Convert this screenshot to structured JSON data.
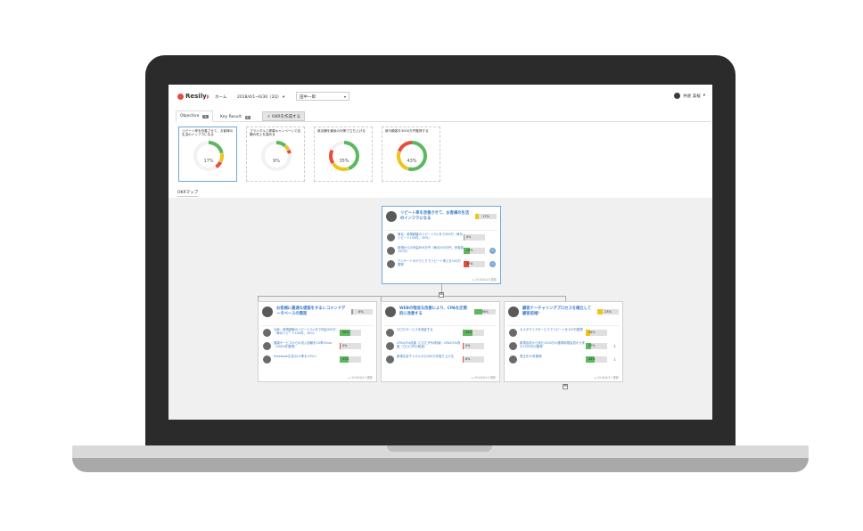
{
  "header": {
    "logo_text": "Resily",
    "logo_sup": "β",
    "nav_home": "ホーム",
    "period": "2018/4/1~6/30（2Q）",
    "period_caret": "▾",
    "dept": "田中一郎",
    "dept_caret": "▾",
    "user_name": "井倉 美桜",
    "user_caret": "▾"
  },
  "tabs": {
    "objective_label": "Objective",
    "objective_count": "4",
    "kr_label": "Key Result",
    "kr_count": "8",
    "create_button": "＋ OKRを作成する"
  },
  "objective_cards": [
    {
      "title": "リピート率を改善させて、お客様の生活のインフラになる",
      "progress": 17,
      "pct_text": "17%"
    },
    {
      "title": "ブライダルと健康キャンペーンで店舗の売上を高める",
      "progress": 9,
      "pct_text": "9%"
    },
    {
      "title": "新店舗を最後の対策で立ち上げる",
      "progress": 35,
      "pct_text": "35%"
    },
    {
      "title": "新行顧客を3000万円獲得する",
      "progress": 43,
      "pct_text": "43%"
    }
  ],
  "map": {
    "label": "OKRマップ",
    "expand_symbol": "⊞",
    "root": {
      "title": "リピート率を改善させて、お客様の生活のインフラになる",
      "progress_text": "17%",
      "progress": 17,
      "footer": "◎ 2018/6/18 更新",
      "krs": [
        {
          "text": "東京：新規顧客のリピート3ヶ月で450万（毎月リピート100件、30%）",
          "progress_text": "0%",
          "progress": 0,
          "color": "#999999",
          "icon": ""
        },
        {
          "text": "新規からの利益600万円（毎月200万円、来客各150万）",
          "progress_text": "28%",
          "progress": 28,
          "color": "#5cb85c",
          "icon": "⚠"
        },
        {
          "text": "アンケートのやりとりでリピート率上を150万獲得",
          "progress_text": "23%",
          "progress": 23,
          "color": "#e84c3d",
          "icon": "⚠"
        }
      ]
    },
    "children": [
      {
        "title": "お客様に最適な提案をするレコメンドデータベースの開発",
        "progress_text": "8%",
        "progress": 8,
        "footer": "◎ 2018/6/14 更新",
        "krs": [
          {
            "text": "大阪：新規顧客のリピート3ヶ月で利益450万（毎月リピート100件、30%）",
            "progress_text": "50%",
            "progress": 50,
            "color": "#5cb85c",
            "icon": ""
          },
          {
            "text": "健康サービスからの流入週報をCV率3%up（XXXX件獲得）",
            "progress_text": "0%",
            "progress": 0,
            "color": "#e84c3d",
            "icon": ""
          },
          {
            "text": "Facebook広告のCV率を15%へ",
            "progress_text": "41%",
            "progress": 41,
            "color": "#5cb85c",
            "icon": ""
          }
        ]
      },
      {
        "title": "WEBの物流な改善により、CPAを圧倒的に改善する",
        "progress_text": "36%",
        "progress": 36,
        "footer": "◎ 2018/6/14 更新",
        "krs": [
          {
            "text": "〇〇〇サービスを検証する",
            "progress_text": "44%",
            "progress": 44,
            "color": "#5cb85c",
            "icon": ""
          },
          {
            "text": "CPAの5%改善（〇〇〇円の削減）CPAの5%改善（〇〇〇円の削減）",
            "progress_text": "0%",
            "progress": 0,
            "color": "#e84c3d",
            "icon": ""
          },
          {
            "text": "新規広告チャネルから500万を取り上げる",
            "progress_text": "6%",
            "progress": 6,
            "color": "#e84c3d",
            "icon": ""
          }
        ]
      },
      {
        "title": "顧客ナーチャリングプロセスを確立して顧客倍増！",
        "progress_text": "23%",
        "progress": 23,
        "footer": "◎ 2018/6/17 更新",
        "krs": [
          {
            "text": "カスタマイズサービスでリピートを150万獲得",
            "progress_text": "20%",
            "progress": 20,
            "color": "#f0c419",
            "icon": ""
          },
          {
            "text": "新規会員から来た1500万の獲得新規会員から来た1500万の獲得",
            "progress_text": "27%",
            "progress": 27,
            "color": "#5cb85c",
            "icon": "⤓"
          },
          {
            "text": "受注を20件獲得",
            "progress_text": "40%",
            "progress": 40,
            "color": "#5cb85c",
            "icon": "⤓"
          }
        ]
      }
    ]
  },
  "colors": {
    "green": "#5cb85c",
    "yellow": "#f0c419",
    "red": "#e84c3d",
    "link_blue": "#3a7bc8"
  }
}
